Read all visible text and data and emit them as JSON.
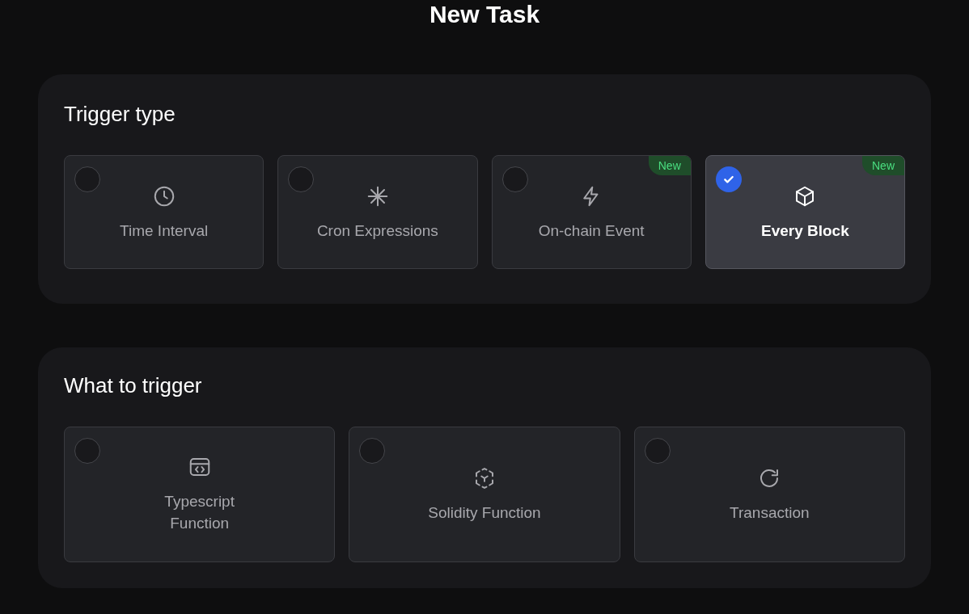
{
  "title": "New Task",
  "sections": [
    {
      "heading": "Trigger type",
      "options": [
        {
          "kind": "clock",
          "label": "Time Interval",
          "selected": false
        },
        {
          "kind": "asterisk",
          "label": "Cron Expressions",
          "selected": false
        },
        {
          "kind": "bolt",
          "label": "On-chain Event",
          "selected": false,
          "badge": "New"
        },
        {
          "kind": "cube",
          "label": "Every Block",
          "selected": true,
          "badge": "New"
        }
      ]
    },
    {
      "heading": "What to trigger",
      "options": [
        {
          "kind": "code",
          "label": "Typescript\nFunction",
          "selected": false
        },
        {
          "kind": "dashedcube",
          "label": "Solidity Function",
          "selected": false
        },
        {
          "kind": "refresh",
          "label": "Transaction",
          "selected": false
        }
      ]
    }
  ]
}
